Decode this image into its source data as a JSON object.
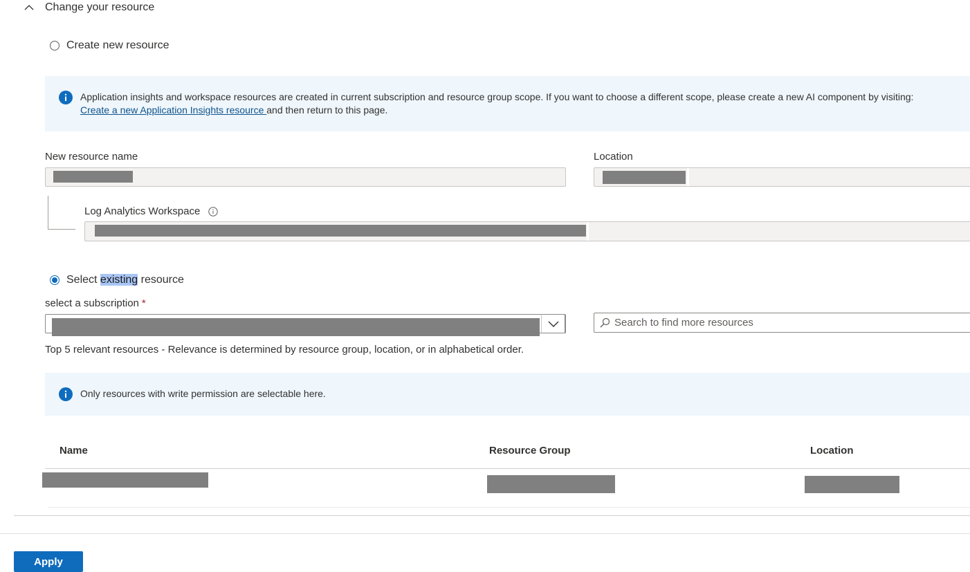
{
  "section": {
    "title": "Change your resource"
  },
  "create_option": {
    "label": "Create new resource",
    "selected": false
  },
  "info_scope": {
    "text": "Application insights and workspace resources are created in current subscription and resource group scope. If you want to choose a different scope, please create a new AI component by visiting:",
    "link_text": "Create a new Application Insights resource ",
    "suffix": "and then return to this page."
  },
  "new_resource": {
    "name_label": "New resource name",
    "location_label": "Location",
    "workspace_label": "Log Analytics Workspace"
  },
  "select_option": {
    "label_before": "Select ",
    "label_highlight": "existing",
    "label_after": " resource",
    "selected": true
  },
  "subscription": {
    "label": "select a subscription",
    "required_mark": "*"
  },
  "search": {
    "placeholder": "Search to find more resources"
  },
  "relevance_note": "Top 5 relevant resources - Relevance is determined by resource group, location, or in alphabetical order.",
  "info_permission": {
    "text": "Only resources with write permission are selectable here."
  },
  "table": {
    "headers": [
      "Name",
      "Resource Group",
      "Location"
    ]
  },
  "apply_label": "Apply",
  "colors": {
    "accent": "#0f6cbd",
    "info_bg": "#eff6fc",
    "redaction": "#808080"
  }
}
